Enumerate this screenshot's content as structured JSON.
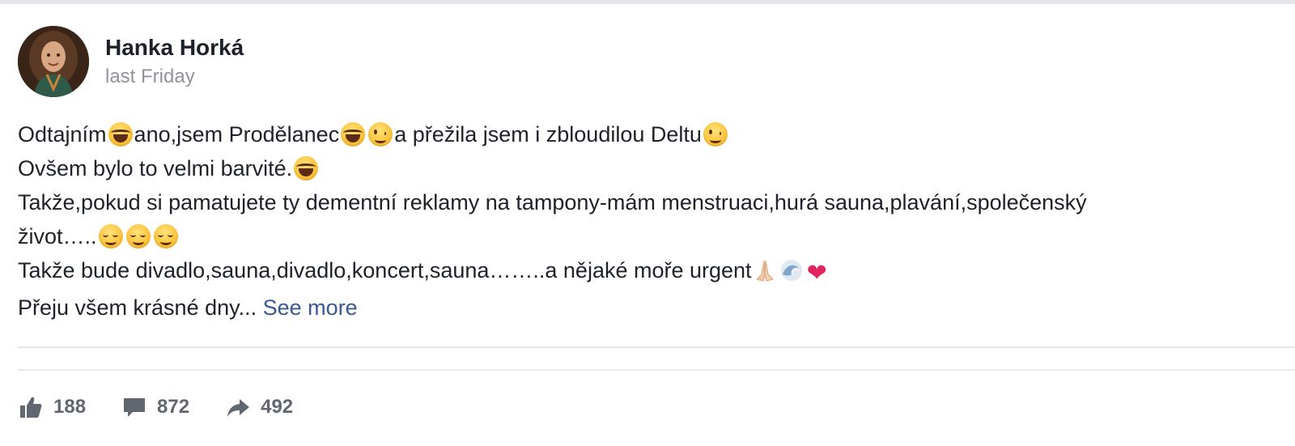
{
  "post": {
    "author": "Hanka Horká",
    "timestamp": "last Friday",
    "lines": {
      "l1_a": "Odtajním",
      "l1_b": "ano,jsem Prodělanec",
      "l1_c": "a přežila jsem i zbloudilou Deltu",
      "l2_a": "Ovšem bylo to velmi barvité.",
      "l3_a": "Takže,pokud si pamatujete ty dementní reklamy na tampony-mám menstruaci,hurá sauna,plavání,společenský",
      "l4_a": "život…..",
      "l5_a": "Takže bude divadlo,sauna,divadlo,koncert,sauna……..a nějaké moře urgent",
      "l6_a": "Přeju všem krásné dny..."
    },
    "see_more": "See more",
    "emojis": {
      "laugh": "face-with-tears-of-joy",
      "wink": "winking-face",
      "smile": "smiling-face-with-smiling-eyes",
      "pray": "folded-hands",
      "wave": "water-wave",
      "heart": "red-heart"
    }
  },
  "stats": {
    "likes": "188",
    "comments": "872",
    "shares": "492"
  },
  "colors": {
    "link": "#385898",
    "text": "#1d2129",
    "muted": "#90949c",
    "icon": "#616770"
  }
}
